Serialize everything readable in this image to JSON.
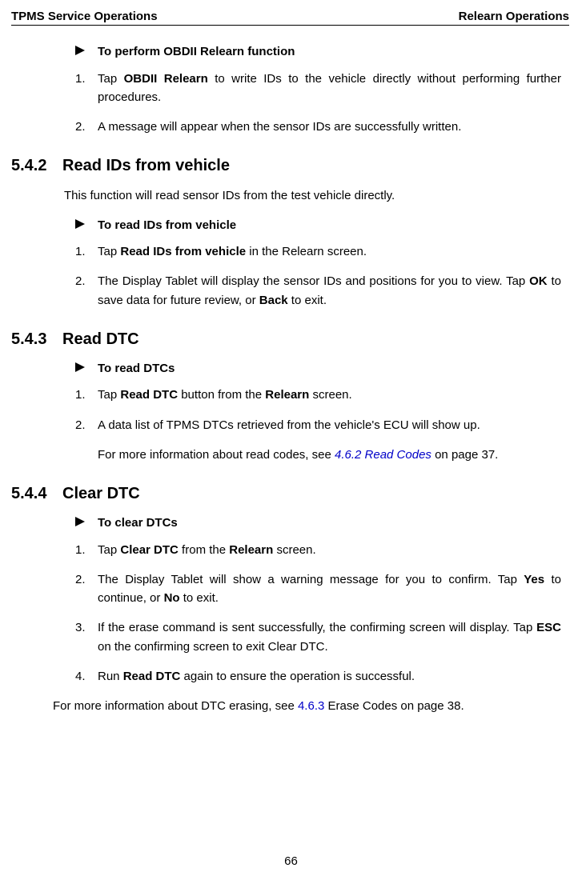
{
  "header": {
    "left": "TPMS Service Operations",
    "right": "Relearn Operations"
  },
  "sec0": {
    "arrow": "To perform OBDII Relearn function",
    "i1_pre": "Tap ",
    "i1_b": "OBDII Relearn",
    "i1_post": " to write IDs to the vehicle directly without performing further procedures.",
    "i2": "A message will appear when the sensor IDs are successfully written."
  },
  "sec542": {
    "num": "5.4.2",
    "title": "Read IDs from vehicle",
    "intro": "This function will read sensor IDs from the test vehicle directly.",
    "arrow": "To read IDs from vehicle",
    "i1_pre": "Tap ",
    "i1_b": "Read IDs from vehicle",
    "i1_post": " in the Relearn screen.",
    "i2_a": "The Display Tablet will display the sensor IDs and positions for you to view. Tap ",
    "i2_b1": "OK",
    "i2_c": " to save data for future review, or ",
    "i2_b2": "Back",
    "i2_d": " to exit."
  },
  "sec543": {
    "num": "5.4.3",
    "title": "Read DTC",
    "arrow": "To read DTCs",
    "i1_pre": "Tap ",
    "i1_b": "Read DTC",
    "i1_mid": " button from the ",
    "i1_b2": "Relearn",
    "i1_post": " screen.",
    "i2": "A data list of TPMS DTCs retrieved from the vehicle's ECU will show up.",
    "extra_a": "For more information about read codes, see ",
    "extra_link": "4.6.2 Read Codes",
    "extra_b": " on page 37."
  },
  "sec544": {
    "num": "5.4.4",
    "title": "Clear DTC",
    "arrow": "To clear DTCs",
    "i1_pre": "Tap ",
    "i1_b": "Clear DTC",
    "i1_mid": " from the ",
    "i1_b2": "Relearn",
    "i1_post": " screen.",
    "i2_a": "The Display Tablet will show a warning message for you to confirm. Tap ",
    "i2_b1": "Yes",
    "i2_c": " to continue, or ",
    "i2_b2": "No",
    "i2_d": " to exit.",
    "i3_a": "If the erase command is sent successfully, the confirming screen will display. Tap ",
    "i3_b": "ESC",
    "i3_c": " on the confirming screen to exit Clear DTC.",
    "i4_a": "Run ",
    "i4_b": "Read DTC",
    "i4_c": " again to ensure the operation is successful.",
    "footer_a": "For more information about DTC erasing, see ",
    "footer_link": "4.6.3",
    "footer_b": " Erase Codes on page 38."
  },
  "nums": {
    "n1": "1.",
    "n2": "2.",
    "n3": "3.",
    "n4": "4."
  },
  "page": "66"
}
